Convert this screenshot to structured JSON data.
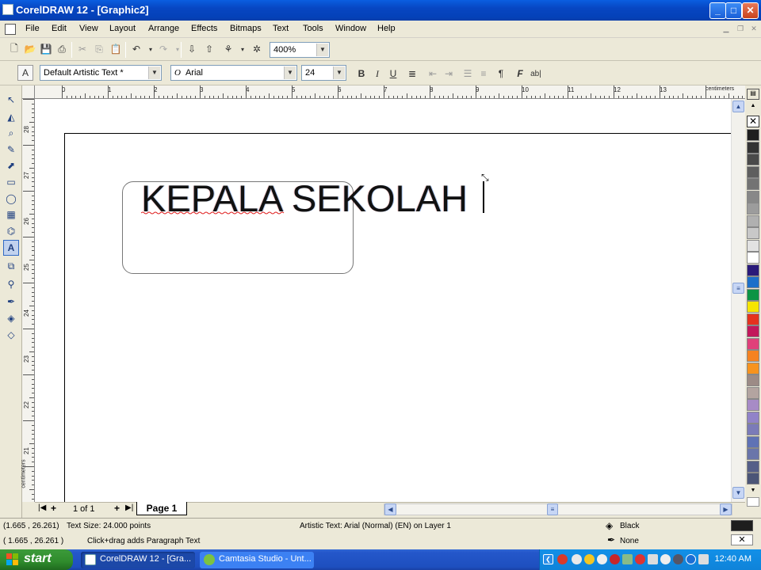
{
  "window": {
    "title": "CorelDRAW 12 - [Graphic2]",
    "min": "_",
    "max": "□",
    "close": "✕"
  },
  "menu": [
    "File",
    "Edit",
    "View",
    "Layout",
    "Arrange",
    "Effects",
    "Bitmaps",
    "Text",
    "Tools",
    "Window",
    "Help"
  ],
  "standard_toolbar": {
    "zoom": "400%"
  },
  "property_bar": {
    "text_style": "Default Artistic Text *",
    "font": "Arial",
    "size": "24",
    "font_icon": "O"
  },
  "rulers": {
    "h_numbers": [
      "0",
      "1",
      "2",
      "3",
      "4",
      "5",
      "6",
      "7",
      "8",
      "9",
      "10",
      "11",
      "12",
      "13"
    ],
    "h_unit": "centimeters",
    "v_numbers": [
      "28",
      "27",
      "26",
      "25",
      "24",
      "23",
      "22",
      "21"
    ],
    "v_unit": "centimeters"
  },
  "canvas": {
    "text": "KEPALA SEKOLAH"
  },
  "page_nav": {
    "count": "1 of 1",
    "tab": "Page 1"
  },
  "status": {
    "coords1": "(1.665 , 26.261)",
    "text_size": "Text Size: 24.000 points",
    "object_info": "Artistic Text: Arial (Normal) (EN) on Layer 1",
    "fill_label": "Black",
    "coords2": "( 1.665 , 26.261 )",
    "hint": "Click+drag adds Paragraph Text",
    "outline_label": "None"
  },
  "palette_colors": [
    "#1e1e1e",
    "#333333",
    "#4a4a4a",
    "#5e5e5e",
    "#737373",
    "#888888",
    "#9c9c9c",
    "#b0b0b0",
    "#c8c8c8",
    "#e2e2e2",
    "#ffffff",
    "#2a1a7a",
    "#1d6fc9",
    "#0b9444",
    "#f6e500",
    "#e5321e",
    "#c2185b",
    "#e0407a",
    "#f58220",
    "#f7931e",
    "#9c8b86",
    "#b3a4a0",
    "#a78bc6",
    "#9183c8",
    "#7b7bb8",
    "#5f72b5",
    "#6a75aa",
    "#555e88",
    "#4b5577"
  ],
  "taskbar": {
    "start": "start",
    "tasks": [
      "CorelDRAW 12 - [Gra...",
      "Camtasia Studio - Unt..."
    ],
    "clock": "12:40 AM"
  }
}
